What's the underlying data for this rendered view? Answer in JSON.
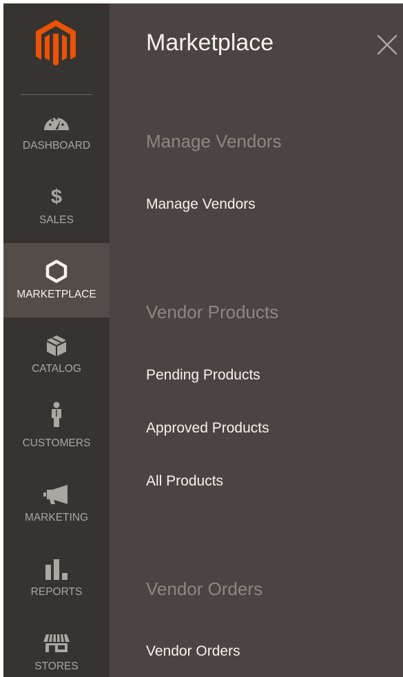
{
  "sidebar": {
    "logo_icon": "magento-logo-icon",
    "items": [
      {
        "label": "DASHBOARD",
        "icon": "speedometer-icon"
      },
      {
        "label": "SALES",
        "icon": "dollar-icon"
      },
      {
        "label": "MARKETPLACE",
        "icon": "hexagon-icon",
        "active": true
      },
      {
        "label": "CATALOG",
        "icon": "cube-icon"
      },
      {
        "label": "CUSTOMERS",
        "icon": "person-icon"
      },
      {
        "label": "MARKETING",
        "icon": "megaphone-icon"
      },
      {
        "label": "REPORTS",
        "icon": "bar-chart-icon"
      },
      {
        "label": "STORES",
        "icon": "storefront-icon"
      }
    ],
    "sales_glyph": "$"
  },
  "panel": {
    "title": "Marketplace",
    "close_icon": "close-icon",
    "sections": [
      {
        "title": "Manage Vendors",
        "links": [
          "Manage Vendors"
        ]
      },
      {
        "title": "Vendor Products",
        "links": [
          "Pending Products",
          "Approved Products",
          "All Products"
        ]
      },
      {
        "title": "Vendor Orders",
        "links": [
          "Vendor Orders"
        ]
      }
    ]
  },
  "colors": {
    "sidebar_bg": "#373330",
    "active_bg": "#524d49",
    "panel_bg": "#4a4542",
    "brand_orange": "#eb5202",
    "text_light": "#f7f3eb",
    "text_muted": "#aaa6a0",
    "section_title": "#8d8780"
  }
}
